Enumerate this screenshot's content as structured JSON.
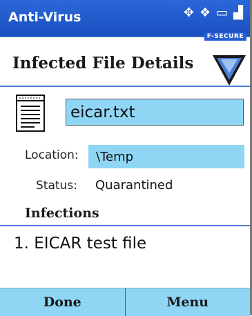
{
  "header": {
    "app_title": "Anti-Virus",
    "brand": "F-SECURE",
    "status_icons": [
      "sync-icon",
      "windows-flag-icon",
      "battery-icon",
      "signal-icon"
    ]
  },
  "page": {
    "title": "Infected File Details"
  },
  "file": {
    "name": "eicar.txt",
    "location_label": "Location:",
    "location_value": "\\Temp",
    "status_label": "Status:",
    "status_value": "Quarantined"
  },
  "infections": {
    "title": "Infections",
    "items": [
      "1.  EICAR test file"
    ]
  },
  "softkeys": {
    "left": "Done",
    "right": "Menu"
  },
  "colors": {
    "title_bar": "#1a4fbf",
    "field_highlight": "#8fd6f5",
    "divider": "#4c7ed9"
  }
}
